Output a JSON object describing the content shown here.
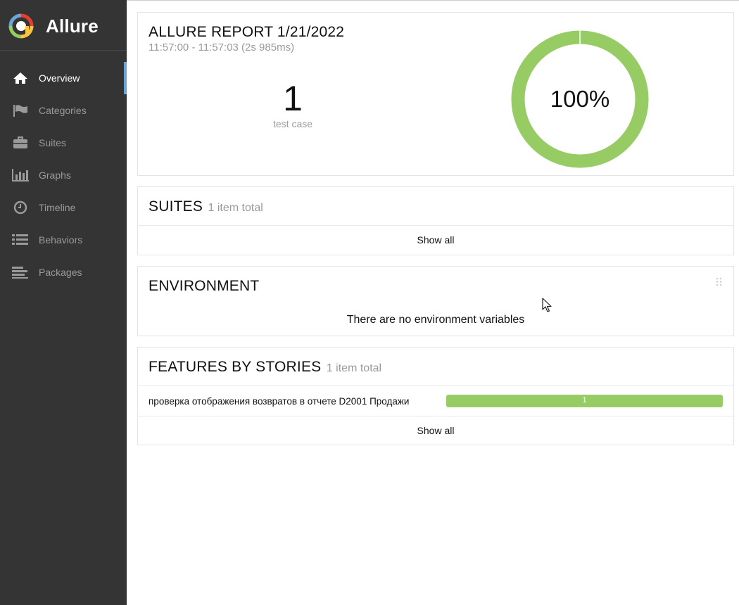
{
  "app": {
    "name": "Allure"
  },
  "sidebar": {
    "items": [
      {
        "label": "Overview",
        "icon": "home-icon",
        "active": true
      },
      {
        "label": "Categories",
        "icon": "flag-icon"
      },
      {
        "label": "Suites",
        "icon": "briefcase-icon"
      },
      {
        "label": "Graphs",
        "icon": "bar-chart-icon"
      },
      {
        "label": "Timeline",
        "icon": "clock-icon"
      },
      {
        "label": "Behaviors",
        "icon": "list-icon"
      },
      {
        "label": "Packages",
        "icon": "align-left-icon"
      }
    ]
  },
  "summary": {
    "title": "ALLURE REPORT 1/21/2022",
    "time": "11:57:00 - 11:57:03 (2s 985ms)",
    "count": "1",
    "count_label": "test case",
    "percent_label": "100%",
    "passed_fraction": 1.0,
    "pass_color": "#97cc64"
  },
  "suites": {
    "title": "SUITES",
    "subtitle": "1 item total",
    "show_all": "Show all"
  },
  "environment": {
    "title": "ENVIRONMENT",
    "empty_text": "There are no environment variables"
  },
  "features": {
    "title": "FEATURES BY STORIES",
    "subtitle": "1 item total",
    "rows": [
      {
        "name": "проверка отображения возвратов в отчете D2001 Продажи",
        "count": "1",
        "passed_fraction": 1.0
      }
    ],
    "show_all": "Show all"
  },
  "colors": {
    "sidebar_bg": "#343434",
    "accent": "#6aa5d6",
    "passed": "#97cc64"
  }
}
